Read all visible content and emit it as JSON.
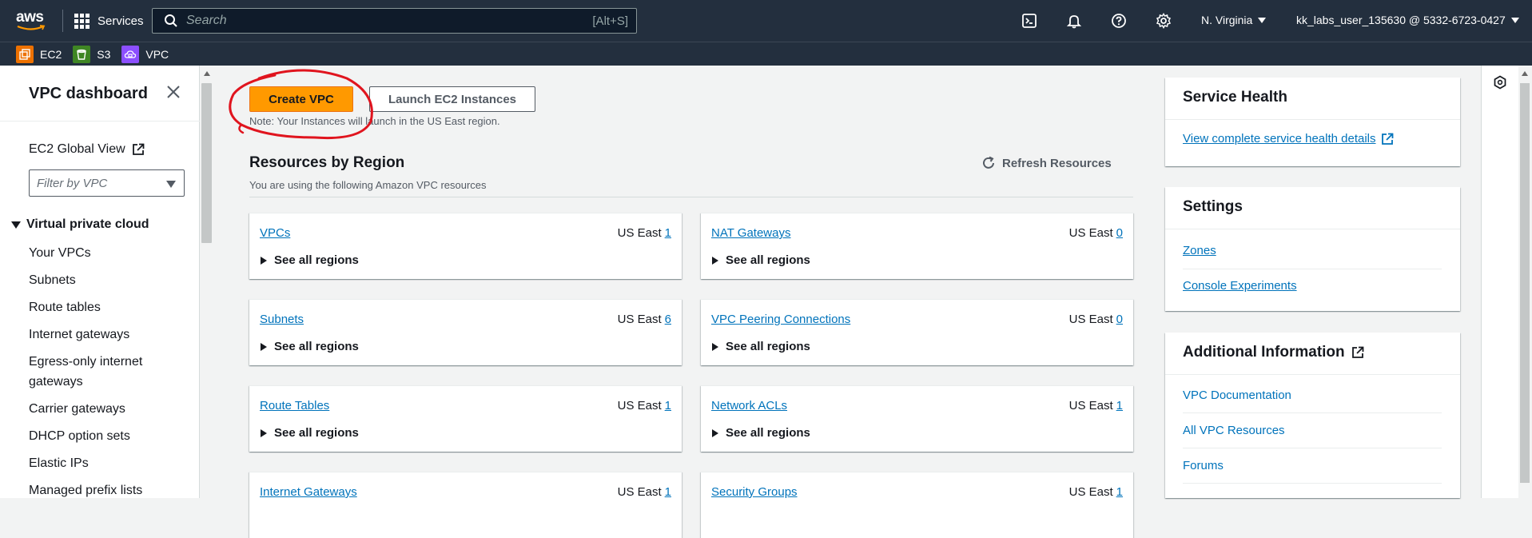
{
  "topnav": {
    "logo": "aws",
    "services_label": "Services",
    "search_placeholder": "Search",
    "search_shortcut": "[Alt+S]",
    "region": "N. Virginia",
    "account": "kk_labs_user_135630 @ 5332-6723-0427"
  },
  "favorites": [
    {
      "label": "EC2",
      "color": "#ed7100"
    },
    {
      "label": "S3",
      "color": "#3f8624"
    },
    {
      "label": "VPC",
      "color": "#8c4fff"
    }
  ],
  "sidebar": {
    "title": "VPC dashboard",
    "global_view": "EC2 Global View",
    "filter_placeholder": "Filter by VPC",
    "section": "Virtual private cloud",
    "items": [
      "Your VPCs",
      "Subnets",
      "Route tables",
      "Internet gateways",
      "Egress-only internet gateways",
      "Carrier gateways",
      "DHCP option sets",
      "Elastic IPs",
      "Managed prefix lists"
    ]
  },
  "main": {
    "create_vpc": "Create VPC",
    "launch_ec2": "Launch EC2 Instances",
    "note": "Note: Your Instances will launch in the US East region.",
    "resources_title": "Resources by Region",
    "resources_subtitle": "You are using the following Amazon VPC resources",
    "refresh": "Refresh Resources",
    "see_all": "See all regions",
    "region_prefix": "US East",
    "cards": [
      {
        "name": "VPCs",
        "count": "1"
      },
      {
        "name": "NAT Gateways",
        "count": "0"
      },
      {
        "name": "Subnets",
        "count": "6"
      },
      {
        "name": "VPC Peering Connections",
        "count": "0"
      },
      {
        "name": "Route Tables",
        "count": "1"
      },
      {
        "name": "Network ACLs",
        "count": "1"
      },
      {
        "name": "Internet Gateways",
        "count": "1"
      },
      {
        "name": "Security Groups",
        "count": "1"
      }
    ]
  },
  "right_panels": {
    "service_health": {
      "title": "Service Health",
      "link": "View complete service health details"
    },
    "settings": {
      "title": "Settings",
      "links": [
        "Zones",
        "Console Experiments"
      ]
    },
    "additional": {
      "title": "Additional Information",
      "links": [
        "VPC Documentation",
        "All VPC Resources",
        "Forums"
      ]
    }
  },
  "colors": {
    "nav_bg": "#232f3e",
    "primary": "#ff9900",
    "link": "#0073bb",
    "annotation": "#e0141e"
  }
}
